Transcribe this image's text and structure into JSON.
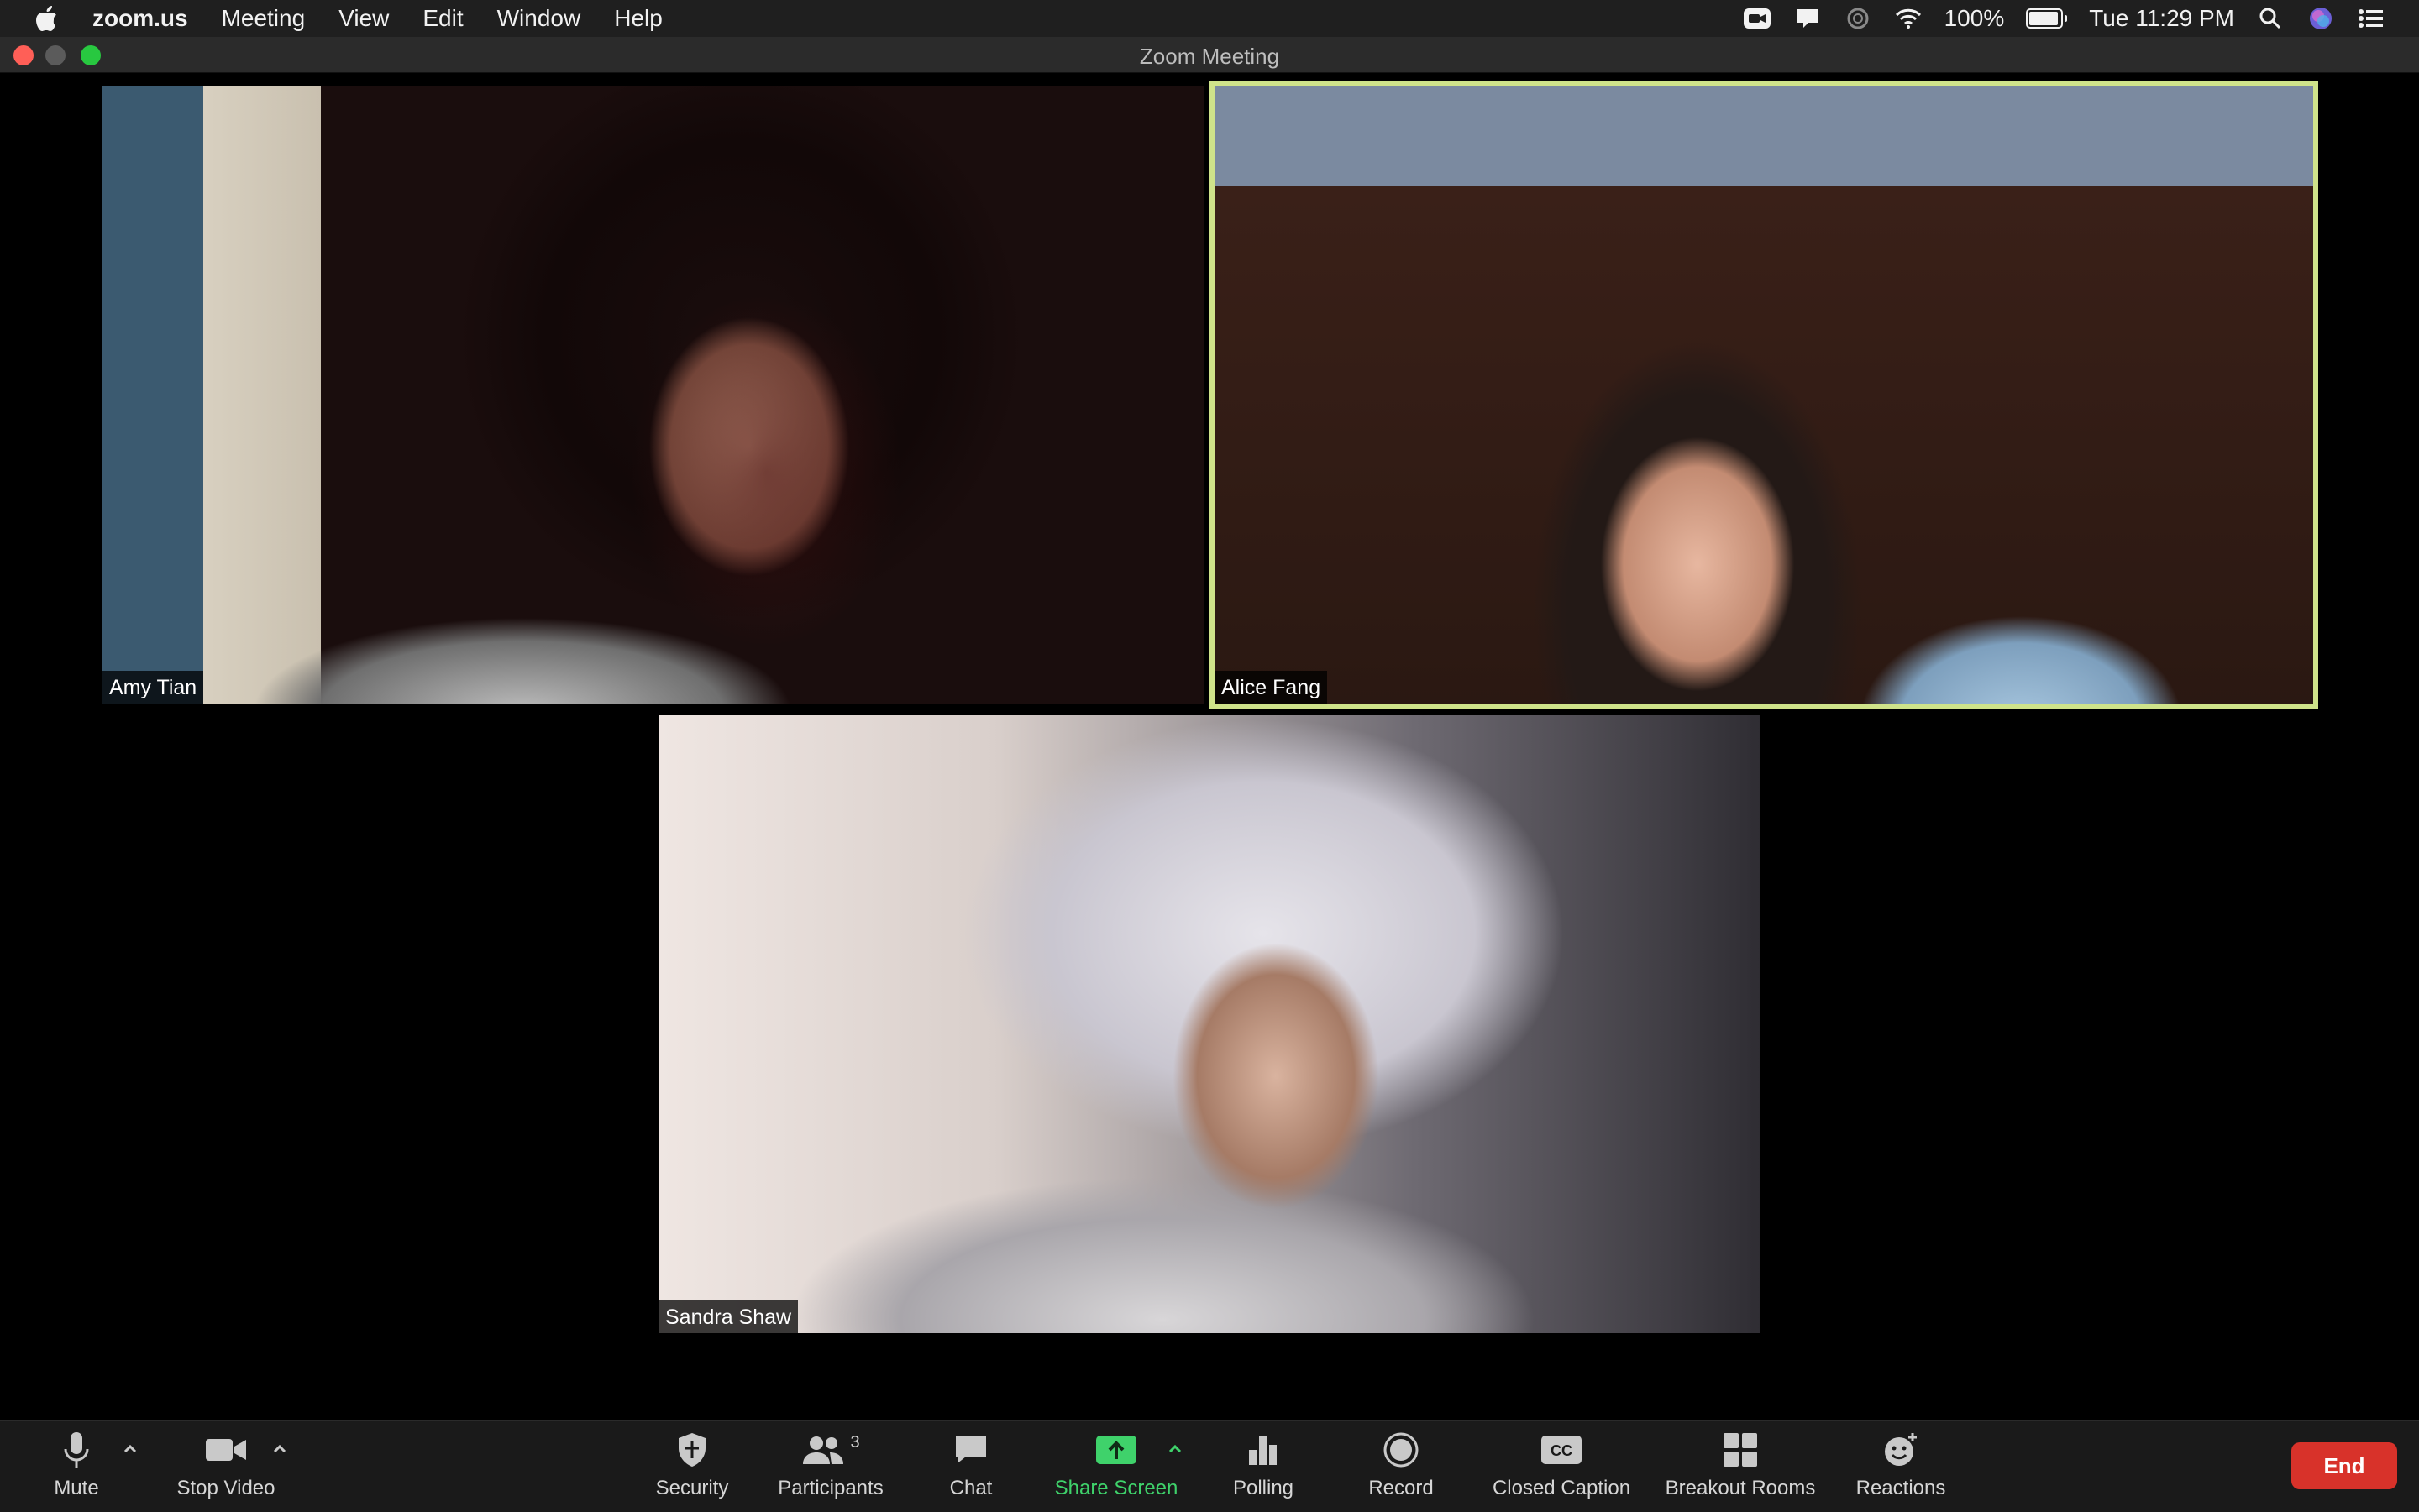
{
  "menubar": {
    "app_name": "zoom.us",
    "items": [
      "Meeting",
      "View",
      "Edit",
      "Window",
      "Help"
    ],
    "battery_percent": "100%",
    "battery_level": 1.0,
    "clock": "Tue 11:29 PM",
    "status_icons": [
      "zoom-camera-icon",
      "notification-icon",
      "do-not-disturb-icon",
      "wifi-icon",
      "battery-icon",
      "spotlight-search-icon",
      "siri-icon",
      "control-center-icon"
    ]
  },
  "window": {
    "title": "Zoom Meeting"
  },
  "participants": [
    {
      "name": "Amy Tian",
      "active_speaker": false
    },
    {
      "name": "Alice Fang",
      "active_speaker": true
    },
    {
      "name": "Sandra Shaw",
      "active_speaker": false
    }
  ],
  "toolbar": {
    "mute_label": "Mute",
    "stop_video_label": "Stop Video",
    "security_label": "Security",
    "participants_label": "Participants",
    "participants_count": "3",
    "chat_label": "Chat",
    "share_screen_label": "Share Screen",
    "polling_label": "Polling",
    "record_label": "Record",
    "closed_caption_label": "Closed Caption",
    "breakout_rooms_label": "Breakout Rooms",
    "reactions_label": "Reactions",
    "end_label": "End"
  },
  "colors": {
    "active_speaker_border": "#cfe38a",
    "share_screen": "#3fd26b",
    "end_button": "#d8322a"
  }
}
